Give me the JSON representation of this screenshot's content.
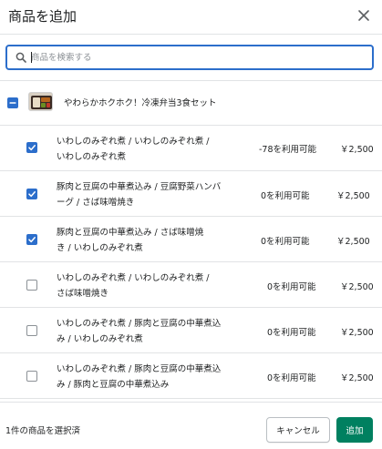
{
  "colors": {
    "primary": "#008060",
    "checkbox": "#2c6ecb",
    "border": "#e1e3e5"
  },
  "header": {
    "title": "商品を追加",
    "close_icon": "close-icon"
  },
  "search": {
    "placeholder": "商品を検索する",
    "value": "",
    "icon": "search-icon"
  },
  "product": {
    "name": "やわらかホクホク！冷凍弁当3食セット",
    "checkbox_state": "indeterminate",
    "thumbnail": "product-thumbnail"
  },
  "variants": [
    {
      "line1": "いわしのみぞれ煮 / いわしのみぞれ煮 /",
      "line2": "いわしのみぞれ煮",
      "stock": "-78を利用可能",
      "price": "￥2,500",
      "checked": true
    },
    {
      "line1": "豚肉と豆腐の中華煮込み / 豆腐野菜ハンバ",
      "line2": "ーグ / さば味噌焼き",
      "stock": "0を利用可能",
      "price": "￥2,500",
      "checked": true
    },
    {
      "line1": "豚肉と豆腐の中華煮込み / さば味噌焼",
      "line2": "き / いわしのみぞれ煮",
      "stock": "0を利用可能",
      "price": "￥2,500",
      "checked": true
    },
    {
      "line1": "いわしのみぞれ煮 / いわしのみぞれ煮 /",
      "line2": "さば味噌焼き",
      "stock": "0を利用可能",
      "price": "￥2,500",
      "checked": false
    },
    {
      "line1": "いわしのみぞれ煮 / 豚肉と豆腐の中華煮込",
      "line2": "み / いわしのみぞれ煮",
      "stock": "0を利用可能",
      "price": "￥2,500",
      "checked": false
    },
    {
      "line1": "いわしのみぞれ煮 / 豚肉と豆腐の中華煮込",
      "line2": "み / 豚肉と豆腐の中華煮込み",
      "stock": "0を利用可能",
      "price": "￥2,500",
      "checked": false
    }
  ],
  "footer": {
    "selected_count": "1件の商品を選択済",
    "cancel_label": "キャンセル",
    "add_label": "追加"
  }
}
